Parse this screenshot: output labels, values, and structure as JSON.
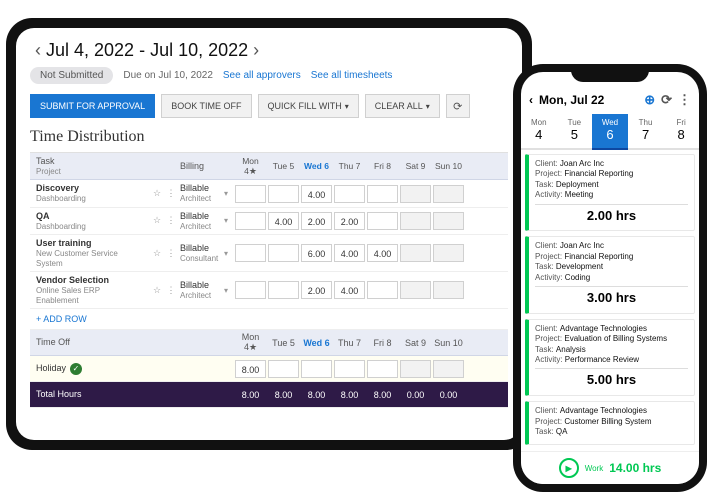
{
  "tablet": {
    "dateRange": "Jul 4, 2022 - Jul 10, 2022",
    "status": "Not Submitted",
    "due": "Due on Jul 10, 2022",
    "linkApprovers": "See all approvers",
    "linkTimesheets": "See all timesheets",
    "btnSubmit": "SUBMIT FOR APPROVAL",
    "btnBook": "BOOK TIME OFF",
    "btnQuick": "QUICK FILL WITH",
    "btnClear": "CLEAR ALL",
    "sectionTitle": "Time Distribution",
    "colTask": "Task",
    "colTaskSub": "Project",
    "colBilling": "Billing",
    "days": [
      "Mon 4",
      "Tue 5",
      "Wed 6",
      "Thu 7",
      "Fri 8",
      "Sat 9",
      "Sun 10"
    ],
    "selectedDayIndex": 2,
    "rows": [
      {
        "task": "Discovery",
        "proj": "Dashboarding",
        "bill": "Billable",
        "role": "Architect",
        "h": [
          "",
          "",
          "4.00",
          "",
          "",
          "",
          ""
        ]
      },
      {
        "task": "QA",
        "proj": "Dashboarding",
        "bill": "Billable",
        "role": "Architect",
        "h": [
          "",
          "4.00",
          "2.00",
          "2.00",
          "",
          "",
          ""
        ]
      },
      {
        "task": "User training",
        "proj": "New Customer Service System",
        "bill": "Billable",
        "role": "Consultant",
        "h": [
          "",
          "",
          "6.00",
          "4.00",
          "4.00",
          "",
          ""
        ]
      },
      {
        "task": "Vendor Selection",
        "proj": "Online Sales ERP Enablement",
        "bill": "Billable",
        "role": "Architect",
        "h": [
          "",
          "",
          "2.00",
          "4.00",
          "",
          "",
          ""
        ]
      }
    ],
    "addRow": "+ ADD ROW",
    "timeOffLabel": "Time Off",
    "holidayLabel": "Holiday",
    "holidayHours": [
      "8.00",
      "",
      "",
      "",
      "",
      "",
      ""
    ],
    "totalLabel": "Total Hours",
    "totals": [
      "8.00",
      "8.00",
      "8.00",
      "8.00",
      "8.00",
      "0.00",
      "0.00"
    ]
  },
  "phone": {
    "title": "Mon, Jul 22",
    "days": [
      {
        "dw": "Mon",
        "dn": "4"
      },
      {
        "dw": "Tue",
        "dn": "5"
      },
      {
        "dw": "Wed",
        "dn": "6"
      },
      {
        "dw": "Thu",
        "dn": "7"
      },
      {
        "dw": "Fri",
        "dn": "8"
      }
    ],
    "selected": 2,
    "cards": [
      {
        "client": "Joan Arc Inc",
        "project": "Financial Reporting",
        "task": "Deployment",
        "activity": "Meeting",
        "hrs": "2.00 hrs"
      },
      {
        "client": "Joan Arc Inc",
        "project": "Financial Reporting",
        "task": "Development",
        "activity": "Coding",
        "hrs": "3.00 hrs"
      },
      {
        "client": "Advantage Technologies",
        "project": "Evaluation of Billing Systems",
        "task": "Analysis",
        "activity": "Performance Review",
        "hrs": "5.00 hrs"
      },
      {
        "client": "Advantage Technologies",
        "project": "Customer Billing System",
        "task": "QA",
        "activity": "",
        "hrs": ""
      }
    ],
    "labels": {
      "client": "Client:",
      "project": "Project:",
      "task": "Task:",
      "activity": "Activity:"
    },
    "footWork": "Work",
    "footHrs": "14.00 hrs"
  }
}
